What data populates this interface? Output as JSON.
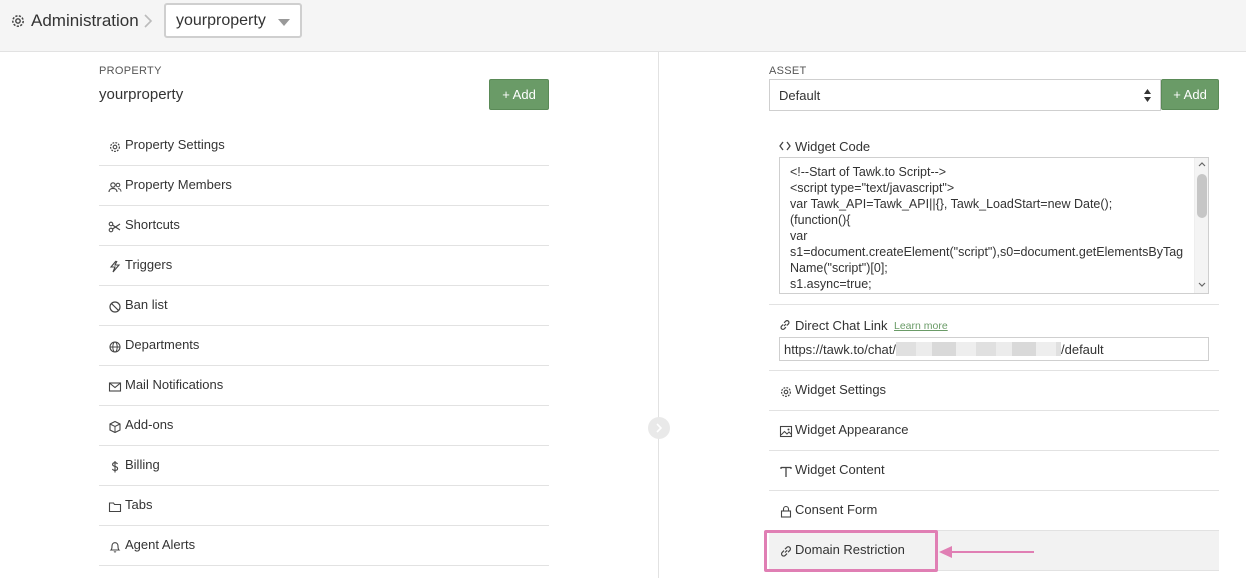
{
  "header": {
    "title": "Administration",
    "property_select_value": "yourproperty"
  },
  "left": {
    "section_label": "PROPERTY",
    "property_name": "yourproperty",
    "add_label": "+ Add",
    "menu": [
      {
        "label": "Property Settings",
        "icon": "gear-icon"
      },
      {
        "label": "Property Members",
        "icon": "users-icon"
      },
      {
        "label": "Shortcuts",
        "icon": "scissors-icon"
      },
      {
        "label": "Triggers",
        "icon": "bolt-icon"
      },
      {
        "label": "Ban list",
        "icon": "ban-icon"
      },
      {
        "label": "Departments",
        "icon": "globe-icon"
      },
      {
        "label": "Mail Notifications",
        "icon": "mail-icon"
      },
      {
        "label": "Add-ons",
        "icon": "box-icon"
      },
      {
        "label": "Billing",
        "icon": "dollar-icon"
      },
      {
        "label": "Tabs",
        "icon": "folder-icon"
      },
      {
        "label": "Agent Alerts",
        "icon": "bell-icon"
      }
    ]
  },
  "right": {
    "section_label": "ASSET",
    "asset_select_value": "Default",
    "add_label": "+ Add",
    "widget_code": {
      "title": "Widget Code",
      "code": "<!--Start of Tawk.to Script-->\n<script type=\"text/javascript\">\nvar Tawk_API=Tawk_API||{}, Tawk_LoadStart=new Date();\n(function(){\nvar\ns1=document.createElement(\"script\"),s0=document.getElementsByTagName(\"script\")[0];\ns1.async=true;"
    },
    "direct_chat_link": {
      "title": "Direct Chat Link",
      "learn_more": "Learn more",
      "url_prefix": "https://tawk.to/chat/",
      "url_suffix": "/default"
    },
    "menu": [
      {
        "label": "Widget Settings",
        "icon": "gear-icon"
      },
      {
        "label": "Widget Appearance",
        "icon": "image-icon"
      },
      {
        "label": "Widget Content",
        "icon": "text-icon"
      },
      {
        "label": "Consent Form",
        "icon": "lock-icon"
      },
      {
        "label": "Domain Restriction",
        "icon": "link-icon"
      }
    ]
  },
  "colors": {
    "accent_green": "#6a9b67",
    "highlight_pink": "#e07fb4"
  }
}
